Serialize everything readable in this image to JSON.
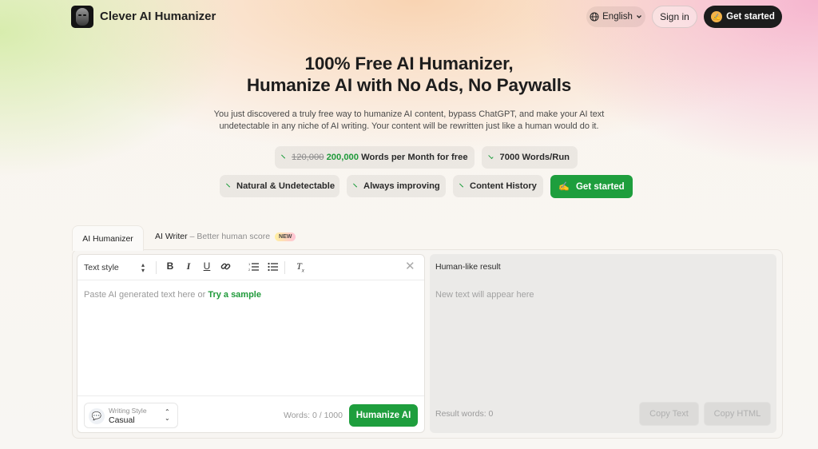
{
  "header": {
    "brand": "Clever AI Humanizer",
    "language": "English",
    "sign_in": "Sign in",
    "get_started": "Get started"
  },
  "hero": {
    "title_line1": "100% Free AI Humanizer,",
    "title_line2": "Humanize AI with No Ads, No Paywalls",
    "subtitle_line1": "You just discovered a truly free way to humanize AI content, bypass ChatGPT, and make your AI text",
    "subtitle_line2": "undetectable in any niche of AI writing. Your content will be rewritten just like a human would do it."
  },
  "features": {
    "words_old": "120,000",
    "words_new": "200,000",
    "words_suffix": "Words per Month for free",
    "per_run": "7000 Words/Run",
    "natural": "Natural & Undetectable",
    "improving": "Always improving",
    "history": "Content History",
    "cta": "Get started"
  },
  "tabs": {
    "humanizer": "AI Humanizer",
    "writer": "AI Writer",
    "writer_hint": "– Better human score",
    "writer_badge": "NEW"
  },
  "editor": {
    "text_style": "Text style",
    "placeholder_text": "Paste AI generated text here or ",
    "try_sample": "Try a sample",
    "writing_style_label": "Writing Style",
    "writing_style_value": "Casual",
    "word_count": "Words: 0 / 1000",
    "humanize_button": "Humanize AI"
  },
  "result": {
    "title": "Human-like result",
    "placeholder": "New text will appear here",
    "word_count": "Result words: 0",
    "copy_text": "Copy Text",
    "copy_html": "Copy HTML"
  },
  "icons": {
    "logo": "robot-face-icon",
    "language": "globe-icon",
    "cta": "writing-hand-icon"
  },
  "colors": {
    "accent_green": "#1e9e3d",
    "dark_button": "#1c1c1c"
  }
}
